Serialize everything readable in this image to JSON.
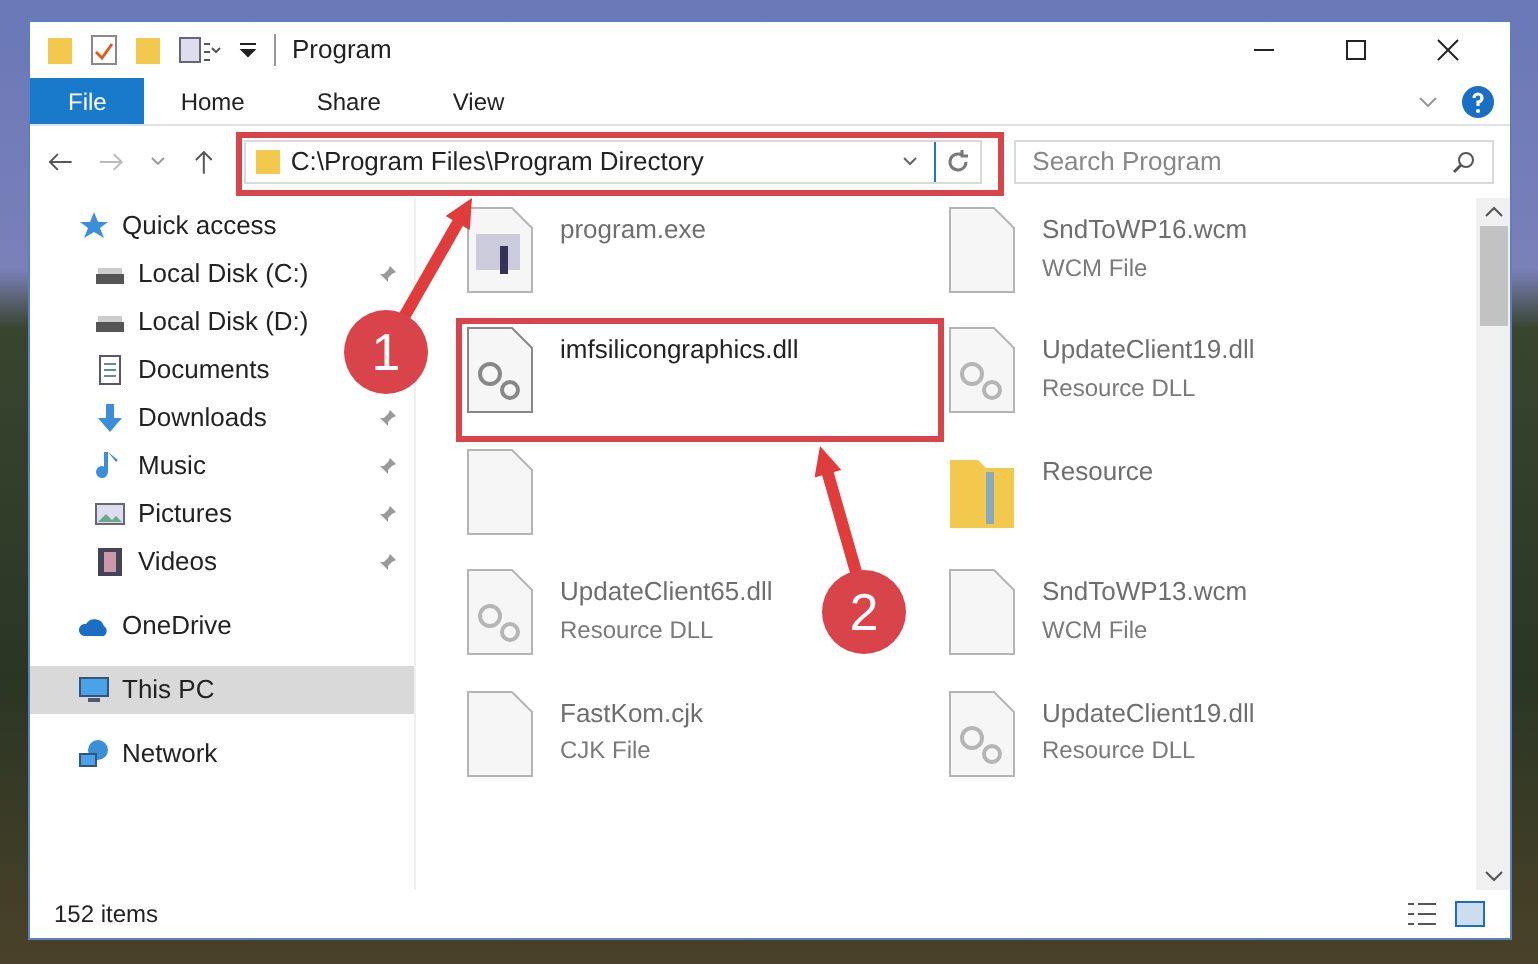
{
  "window": {
    "title": "Program"
  },
  "ribbon_tabs": [
    {
      "label": "File",
      "selected": true
    },
    {
      "label": "Home",
      "selected": false
    },
    {
      "label": "Share",
      "selected": false
    },
    {
      "label": "View",
      "selected": false
    }
  ],
  "address": {
    "path": "C:\\Program Files\\Program Directory"
  },
  "search": {
    "placeholder": "Search Program"
  },
  "sidebar": {
    "items": [
      {
        "label": "Quick access",
        "kind": "star",
        "pinned": false,
        "selected": false
      },
      {
        "label": "Local Disk (C:)",
        "kind": "drive",
        "pinned": true,
        "selected": false
      },
      {
        "label": "Local Disk (D:)",
        "kind": "drive",
        "pinned": false,
        "selected": false
      },
      {
        "label": "Documents",
        "kind": "document",
        "pinned": false,
        "selected": false
      },
      {
        "label": "Downloads",
        "kind": "download",
        "pinned": true,
        "selected": false
      },
      {
        "label": "Music",
        "kind": "music",
        "pinned": true,
        "selected": false
      },
      {
        "label": "Pictures",
        "kind": "pictures",
        "pinned": true,
        "selected": false
      },
      {
        "label": "Videos",
        "kind": "video",
        "pinned": true,
        "selected": false
      },
      {
        "label": "OneDrive",
        "kind": "cloud",
        "pinned": false,
        "selected": false
      },
      {
        "label": "This PC",
        "kind": "pc",
        "pinned": false,
        "selected": true
      },
      {
        "label": "Network",
        "kind": "network",
        "pinned": false,
        "selected": false
      }
    ]
  },
  "files": [
    {
      "name": "program.exe",
      "kind": "exe",
      "dimmed": true
    },
    {
      "name": "SndToWP16.wcm",
      "type": "WCM File",
      "kind": "file",
      "dimmed": true
    },
    {
      "name": "imfsilicongraphics.dll",
      "kind": "dll",
      "dimmed": false
    },
    {
      "name": "UpdateClient19.dll",
      "type": "Resource DLL",
      "kind": "dll",
      "dimmed": true
    },
    {
      "kind": "file",
      "dimmed": true
    },
    {
      "name": "Resource",
      "kind": "folder",
      "dimmed": true
    },
    {
      "name": "UpdateClient65.dll",
      "type": "Resource DLL",
      "kind": "dll",
      "dimmed": true
    },
    {
      "name": "SndToWP13.wcm",
      "type": "WCM File",
      "kind": "file",
      "dimmed": true
    },
    {
      "name": "FastKom.cjk",
      "type": "CJK File",
      "kind": "file",
      "dimmed": true
    },
    {
      "name": "UpdateClient19.dll",
      "type": "Resource DLL",
      "kind": "dll",
      "dimmed": true
    }
  ],
  "status_bar": {
    "count": "152 items"
  },
  "callouts": [
    {
      "number": "1"
    },
    {
      "number": "2"
    }
  ]
}
